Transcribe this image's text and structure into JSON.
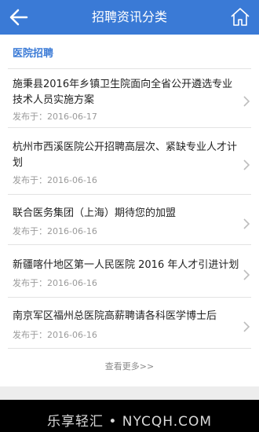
{
  "header": {
    "title": "招聘资讯分类"
  },
  "section": {
    "title": "医院招聘"
  },
  "date_prefix": "发布于：",
  "items": [
    {
      "title": "施秉县2016年乡镇卫生院面向全省公开遴选专业技术人员实施方案",
      "date": "2016-06-17"
    },
    {
      "title": "杭州市西溪医院公开招聘高层次、紧缺专业人才计划",
      "date": "2016-06-16"
    },
    {
      "title": "联合医务集团（上海）期待您的加盟",
      "date": "2016-06-16"
    },
    {
      "title": "新疆喀什地区第一人民医院 2016 年人才引进计划",
      "date": "2016-06-16"
    },
    {
      "title": "南京军区福州总医院高薪聘请各科医学博士后",
      "date": "2016-06-16"
    }
  ],
  "more_label": "查看更多>>",
  "watermark": "乐享轻汇 • NYCQH.COM",
  "colors": {
    "header": "#3a7ad6",
    "accent": "#3a7ad6"
  },
  "icons": {
    "back": "arrow-left-icon",
    "home": "home-icon",
    "chevron": "chevron-right-icon"
  }
}
